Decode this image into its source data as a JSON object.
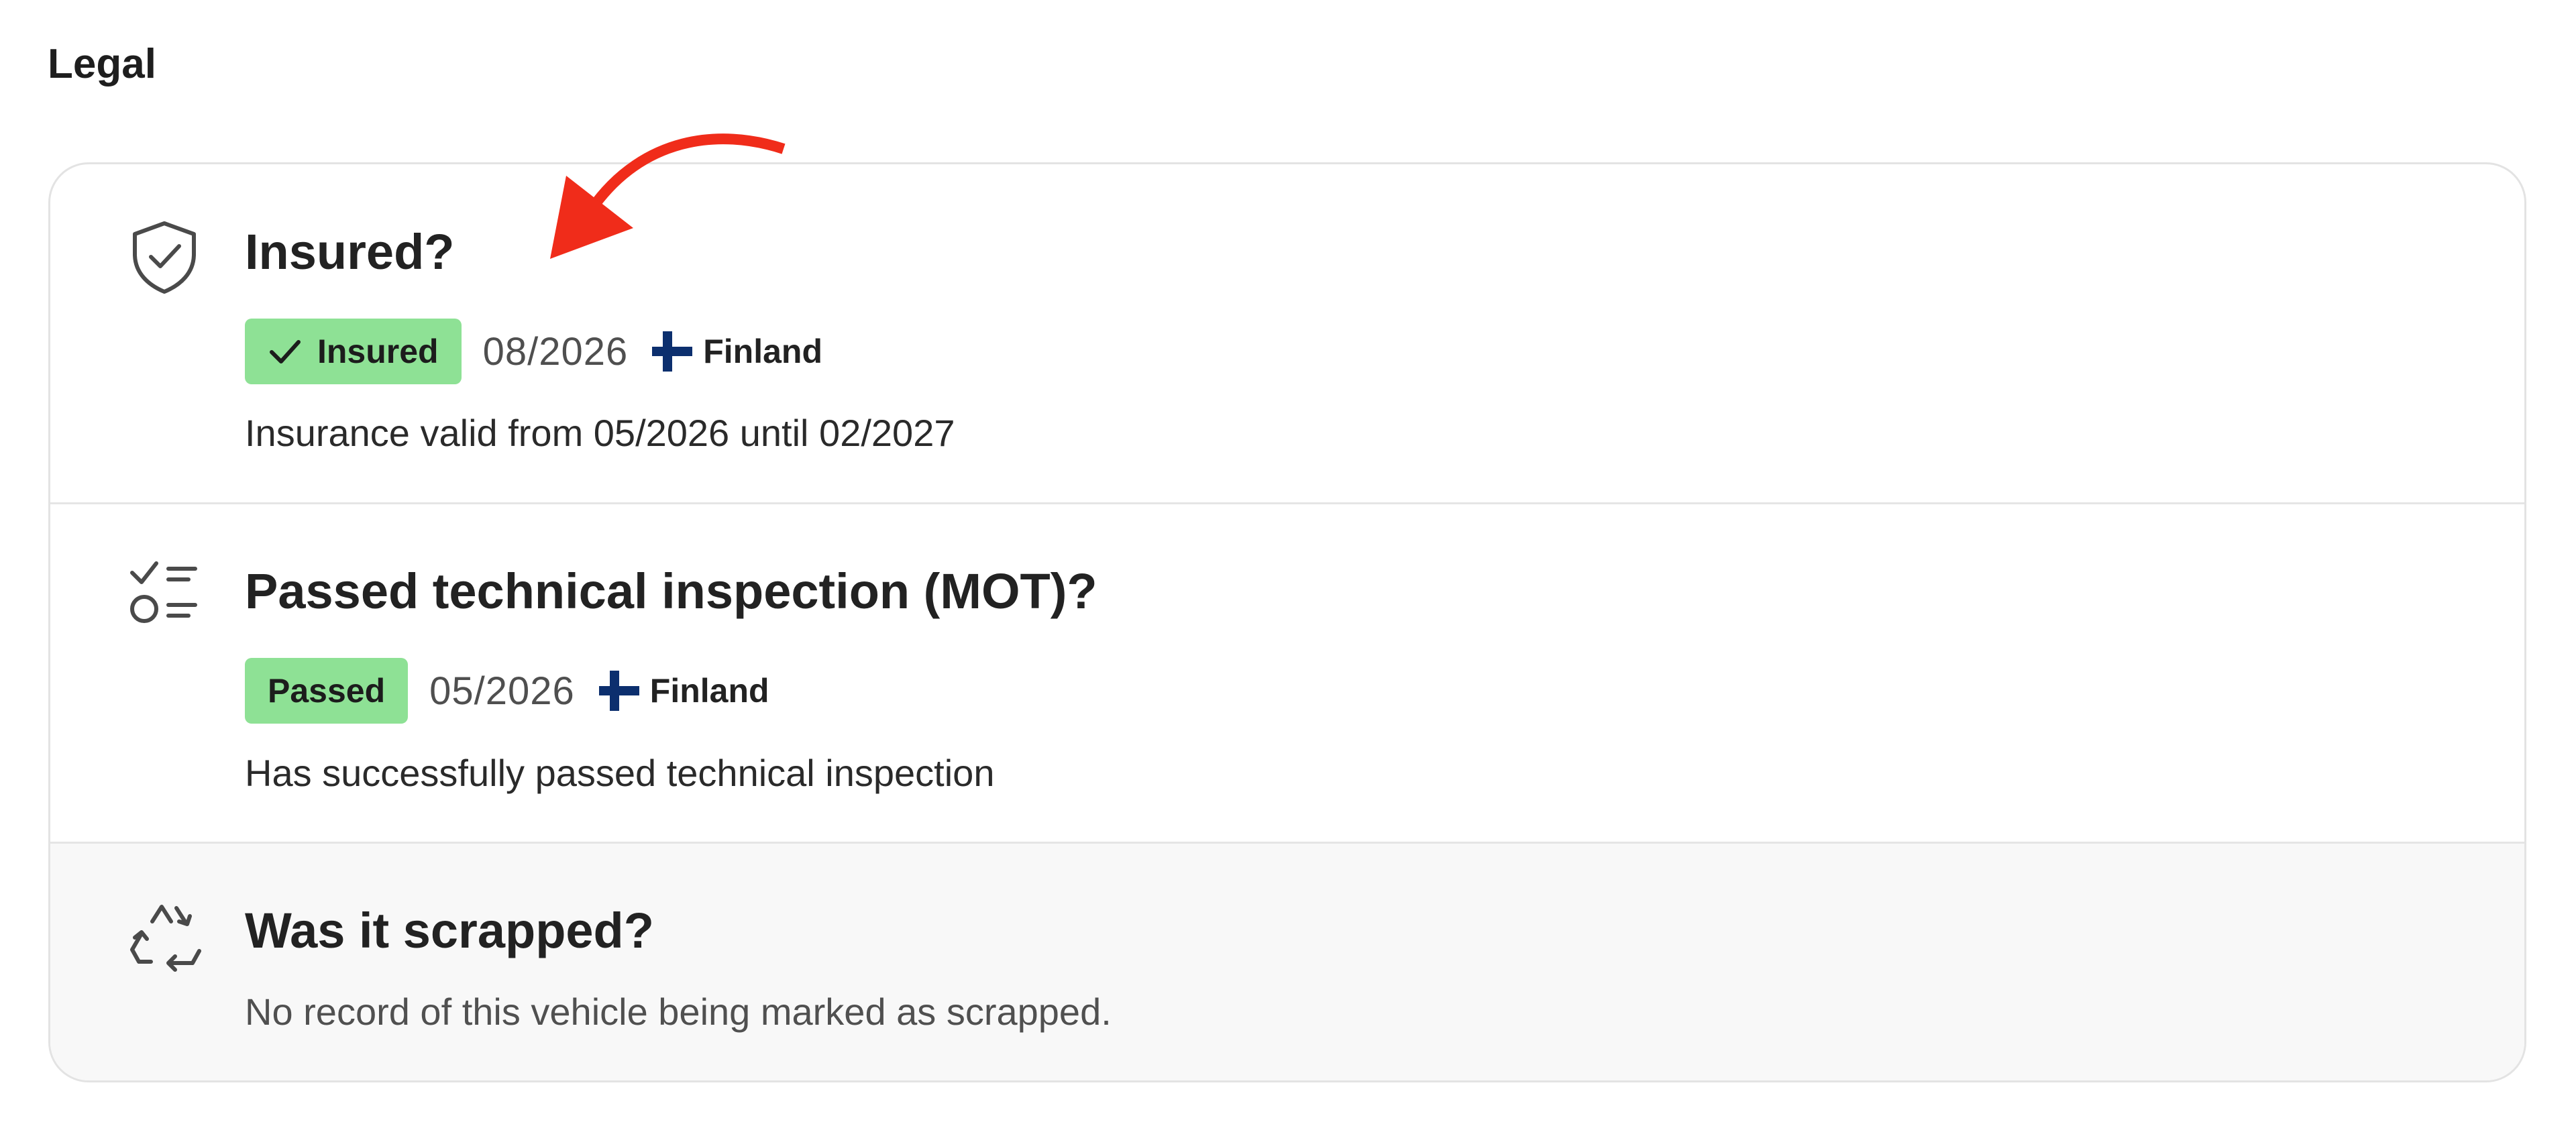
{
  "section": {
    "title": "Legal"
  },
  "colors": {
    "badge_success": "#8ee195",
    "annotation_arrow": "#f02c1a",
    "flag_blue": "#0c2f6e"
  },
  "rows": [
    {
      "icon": "shield-check-icon",
      "title": "Insured?",
      "badge": "Insured",
      "badge_icon": "checkmark-icon",
      "date": "08/2026",
      "country_icon": "finland-flag-icon",
      "country": "Finland",
      "description": "Insurance valid from 05/2026 until 02/2027"
    },
    {
      "icon": "checklist-icon",
      "title": "Passed technical inspection (MOT)?",
      "badge": "Passed",
      "date": "05/2026",
      "country_icon": "finland-flag-icon",
      "country": "Finland",
      "description": "Has successfully passed technical inspection"
    },
    {
      "icon": "recycle-icon",
      "title": "Was it scrapped?",
      "description": "No record of this vehicle being marked as scrapped."
    }
  ],
  "annotation": {
    "icon": "curved-arrow-icon"
  }
}
